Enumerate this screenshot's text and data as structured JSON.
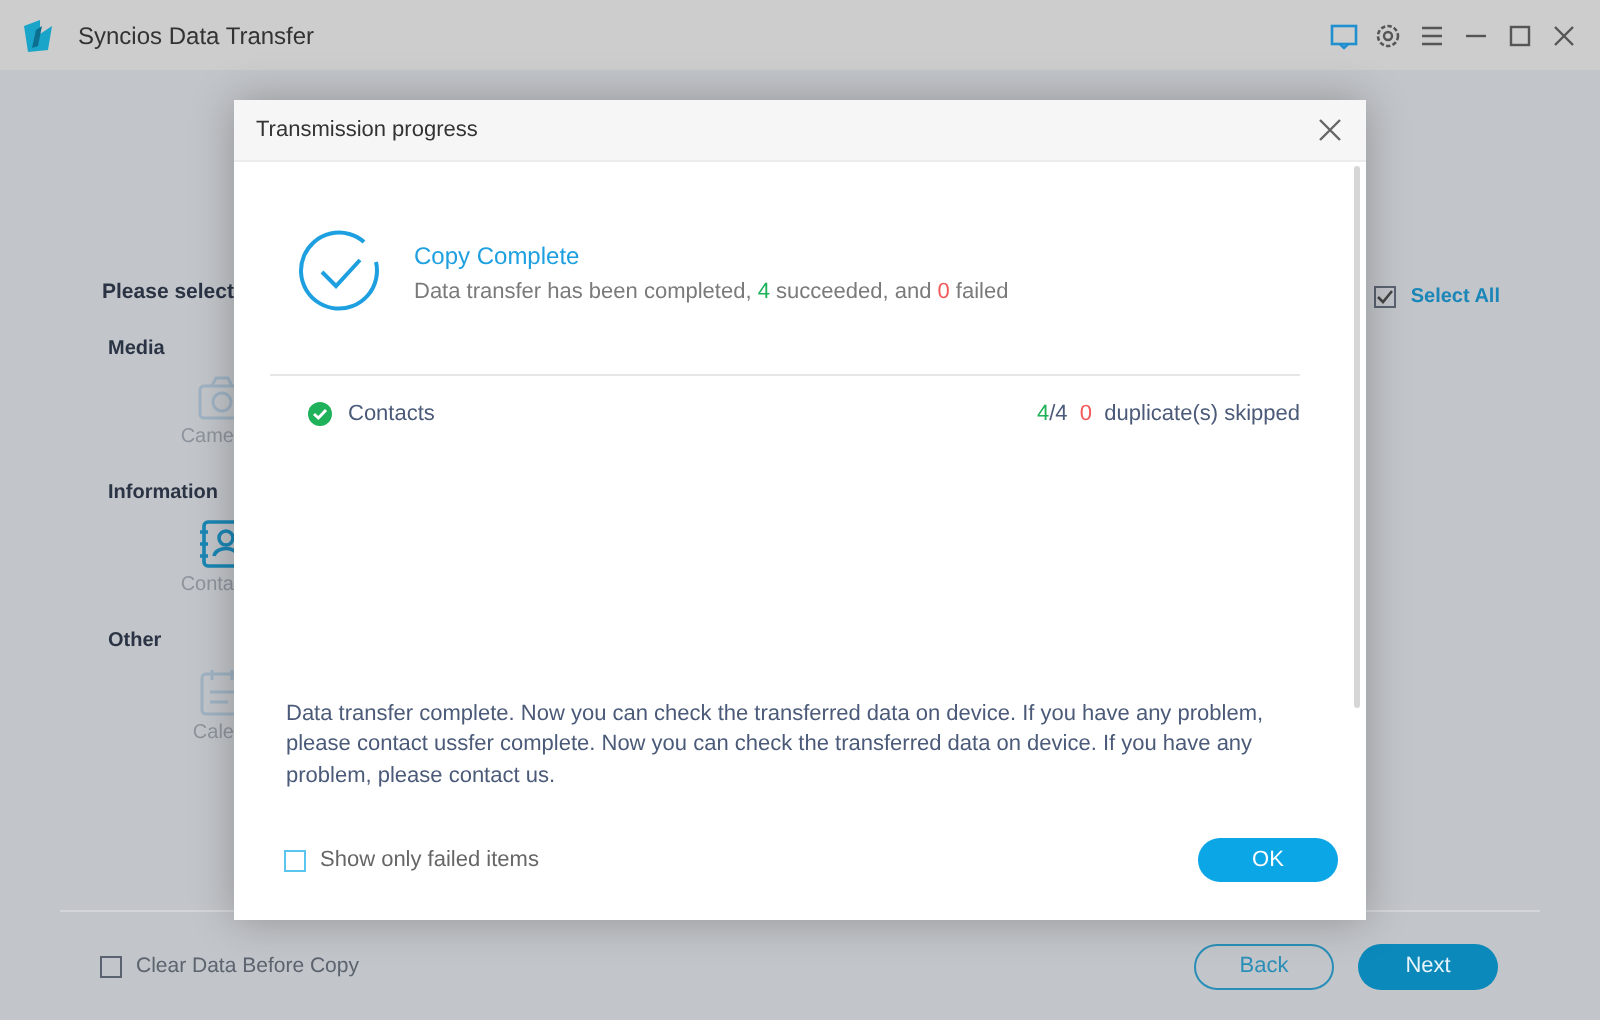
{
  "window": {
    "title": "Syncios Data Transfer"
  },
  "background": {
    "heading": "Please select",
    "select_all": {
      "label": "Select All",
      "checked": true
    },
    "groups": [
      {
        "title": "Media",
        "items": [
          {
            "label": "Came",
            "kind": "camera"
          }
        ]
      },
      {
        "title": "Information",
        "items": [
          {
            "label": "Conta",
            "kind": "contacts"
          }
        ]
      },
      {
        "title": "Other",
        "items": [
          {
            "label": "Cale",
            "kind": "calendar"
          }
        ]
      }
    ],
    "clear_data": {
      "label": "Clear Data Before Copy",
      "checked": false
    },
    "buttons": [
      {
        "label": "Back",
        "kind": "outline"
      },
      {
        "label": "Next",
        "kind": "primary"
      }
    ]
  },
  "dialog": {
    "title": "Transmission progress",
    "status_title": "Copy Complete",
    "summary": [
      {
        "text": "Data transfer has been completed, ",
        "kind": "normal"
      },
      {
        "text": "4",
        "kind": "success"
      },
      {
        "text": " succeeded, and ",
        "kind": "normal"
      },
      {
        "text": "0",
        "kind": "fail"
      },
      {
        "text": " failed",
        "kind": "normal"
      }
    ],
    "items": [
      {
        "name": "Contacts",
        "kind": "success",
        "done": "4",
        "total": "/4",
        "duplicates": "0",
        "duplicates_label": "duplicate(s) skipped"
      }
    ],
    "message": "Data transfer complete. Now you can check the transferred data on device. If you have any problem, please contact ussfer complete. Now you can check the transferred data on device. If you have any problem, please contact us.",
    "show_failed": {
      "label": "Show only failed items",
      "checked": false
    },
    "ok": "OK"
  }
}
